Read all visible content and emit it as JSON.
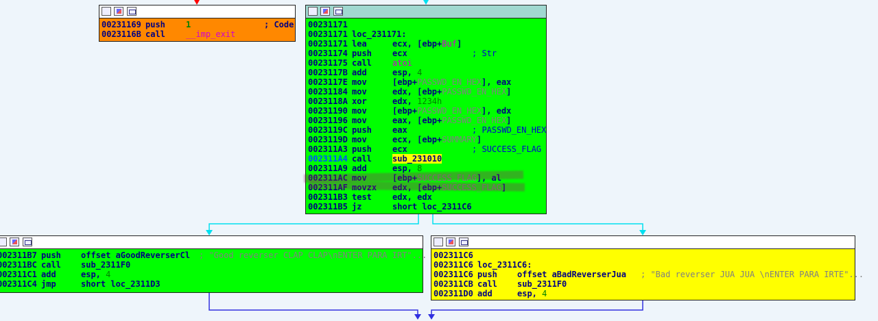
{
  "colors": {
    "background": "#eef5fb",
    "node_orange": "#ff8800",
    "node_green": "#00ff00",
    "node_yellow": "#ffff00",
    "header_main": "#a0d8d0",
    "edge_cyan": "#00e0f0",
    "edge_blue": "#3030e0",
    "edge_red": "#ff0000"
  },
  "icons": [
    "graph-color-icon",
    "edit-node-icon",
    "node-text-icon"
  ],
  "nodes": {
    "exit": {
      "lines": [
        {
          "addr": "00231169",
          "mn": "push",
          "op": "1",
          "cm": "; Code"
        },
        {
          "addr": "0023116B",
          "mn": "call",
          "op": "__imp_exit",
          "cm": ""
        }
      ]
    },
    "main": {
      "lines": [
        {
          "addr": "00231171",
          "mn": "",
          "op": "",
          "cm": ""
        },
        {
          "addr": "00231171",
          "mn": "loc_231171:",
          "op": "",
          "cm": ""
        },
        {
          "addr": "00231171",
          "mn": "lea",
          "op": "ecx, [ebp+Buf]",
          "cm": ""
        },
        {
          "addr": "00231174",
          "mn": "push",
          "op": "ecx",
          "cm": "; Str"
        },
        {
          "addr": "00231175",
          "mn": "call",
          "op": "atoi",
          "cm": ""
        },
        {
          "addr": "0023117B",
          "mn": "add",
          "op": "esp, 4",
          "cm": ""
        },
        {
          "addr": "0023117E",
          "mn": "mov",
          "op": "[ebp+PASSWD_EN_HEX], eax",
          "cm": ""
        },
        {
          "addr": "00231184",
          "mn": "mov",
          "op": "edx, [ebp+PASSWD_EN_HEX]",
          "cm": ""
        },
        {
          "addr": "0023118A",
          "mn": "xor",
          "op": "edx, 1234h",
          "cm": ""
        },
        {
          "addr": "00231190",
          "mn": "mov",
          "op": "[ebp+PASSWD_EN_HEX], edx",
          "cm": ""
        },
        {
          "addr": "00231196",
          "mn": "mov",
          "op": "eax, [ebp+PASSWD_EN_HEX]",
          "cm": ""
        },
        {
          "addr": "0023119C",
          "mn": "push",
          "op": "eax",
          "cm": "; PASSWD_EN_HEX"
        },
        {
          "addr": "0023119D",
          "mn": "mov",
          "op": "ecx, [ebp+SUMMARY]",
          "cm": ""
        },
        {
          "addr": "002311A3",
          "mn": "push",
          "op": "ecx",
          "cm": "; SUCCESS_FLAG"
        },
        {
          "addr": "002311A4",
          "mn": "call",
          "op": "sub_231010",
          "cm": ""
        },
        {
          "addr": "002311A9",
          "mn": "add",
          "op": "esp, 8",
          "cm": ""
        },
        {
          "addr": "002311AC",
          "mn": "mov",
          "op": "[ebp+SUCCESS_FLAG], al",
          "cm": ""
        },
        {
          "addr": "002311AF",
          "mn": "movzx",
          "op": "edx, [ebp+SUCCESS_FLAG]",
          "cm": ""
        },
        {
          "addr": "002311B3",
          "mn": "test",
          "op": "edx, edx",
          "cm": ""
        },
        {
          "addr": "002311B5",
          "mn": "jz",
          "op": "short loc_2311C6",
          "cm": ""
        }
      ]
    },
    "good": {
      "lines": [
        {
          "addr": "002311B7",
          "mn": "push",
          "op": "offset aGoodReverserCl",
          "cm": "; \"Good reverser CLAP CLAP\\nENTER PARA IRT\"..."
        },
        {
          "addr": "002311BC",
          "mn": "call",
          "op": "sub_2311F0",
          "cm": ""
        },
        {
          "addr": "002311C1",
          "mn": "add",
          "op": "esp, 4",
          "cm": ""
        },
        {
          "addr": "002311C4",
          "mn": "jmp",
          "op": "short loc_2311D3",
          "cm": ""
        }
      ]
    },
    "bad": {
      "lines": [
        {
          "addr": "002311C6",
          "mn": "",
          "op": "",
          "cm": ""
        },
        {
          "addr": "002311C6",
          "mn": "loc_2311C6:",
          "op": "",
          "cm": ""
        },
        {
          "addr": "002311C6",
          "mn": "push",
          "op": "offset aBadReverserJua",
          "cm": "; \"Bad reverser JUA JUA \\nENTER PARA IRTE\"..."
        },
        {
          "addr": "002311CB",
          "mn": "call",
          "op": "sub_2311F0",
          "cm": ""
        },
        {
          "addr": "002311D0",
          "mn": "add",
          "op": "esp, 4",
          "cm": ""
        }
      ]
    }
  }
}
